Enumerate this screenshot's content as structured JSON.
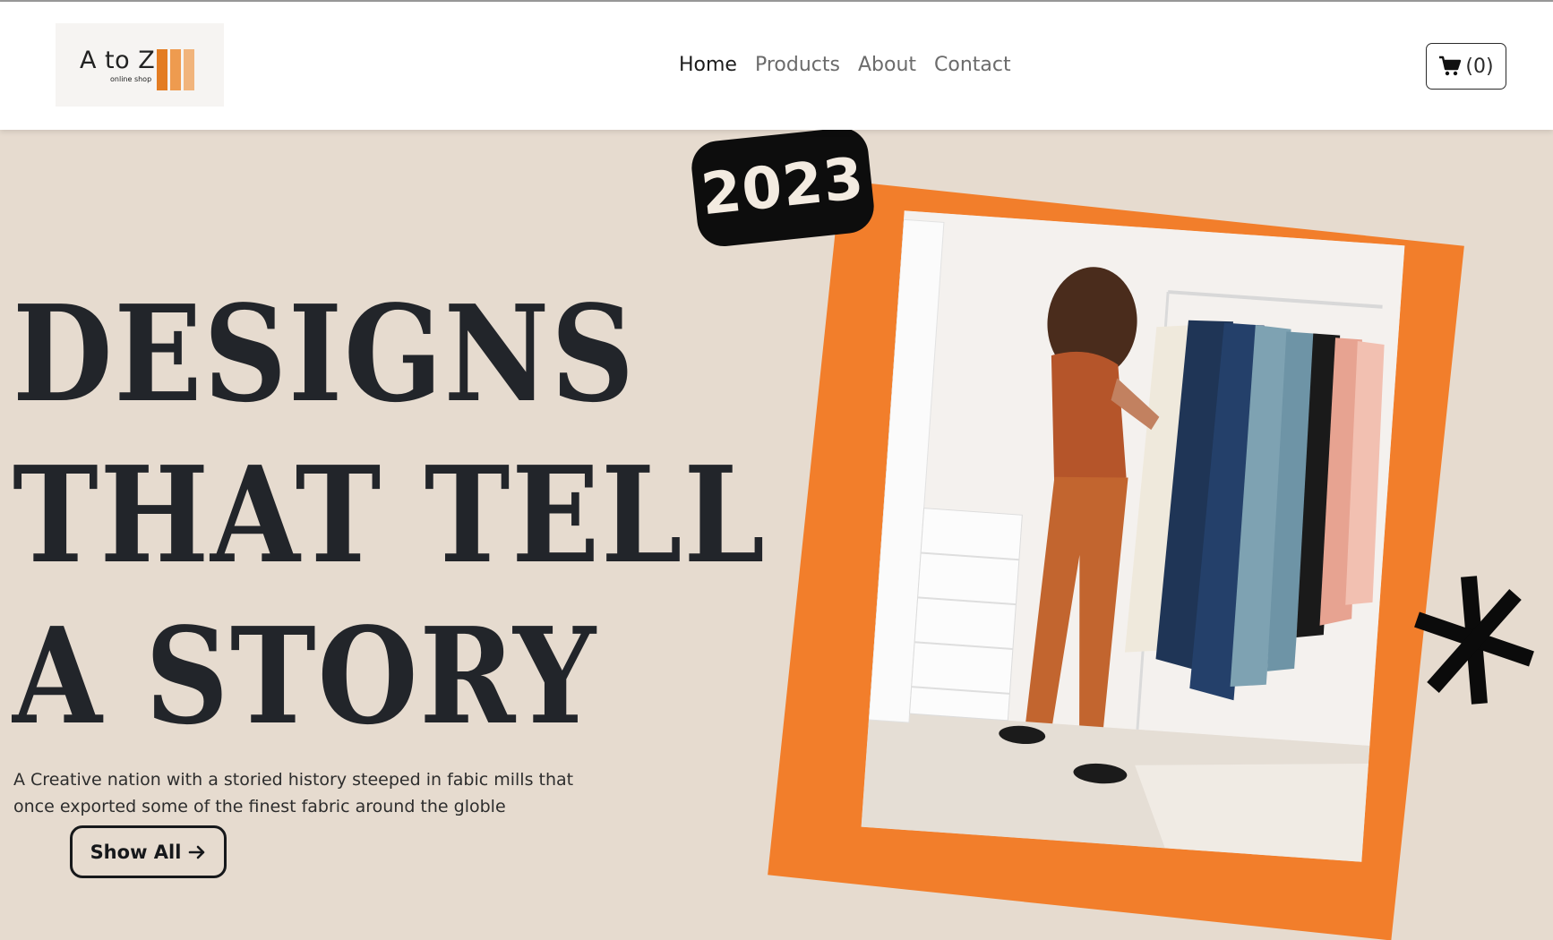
{
  "logo": {
    "text": "A to Z",
    "subtitle": "online shop",
    "bar_colors": [
      "#e37c22",
      "#ee9b4f",
      "#f1b47c"
    ]
  },
  "nav": {
    "items": [
      {
        "label": "Home",
        "active": true
      },
      {
        "label": "Products",
        "active": false
      },
      {
        "label": "About",
        "active": false
      },
      {
        "label": "Contact",
        "active": false
      }
    ]
  },
  "cart": {
    "icon": "shopping-cart-icon",
    "count_label": "(0)"
  },
  "hero": {
    "title_lines": [
      "DESIGNS",
      "THAT TELL",
      "A STORY"
    ],
    "description": "A Creative nation with a storied history steeped in fabic mills that once exported some of the finest fabric around the globle",
    "button_label": "Show All",
    "button_icon": "arrow-right-icon",
    "badge_text": "2023",
    "decor_icon": "asterisk-icon",
    "image_alt": "woman-browsing-clothing-rack"
  },
  "colors": {
    "background": "#e6dbcf",
    "accent_orange": "#f27e2b",
    "text_dark": "#22252a",
    "badge_bg": "#0d0d0d"
  }
}
